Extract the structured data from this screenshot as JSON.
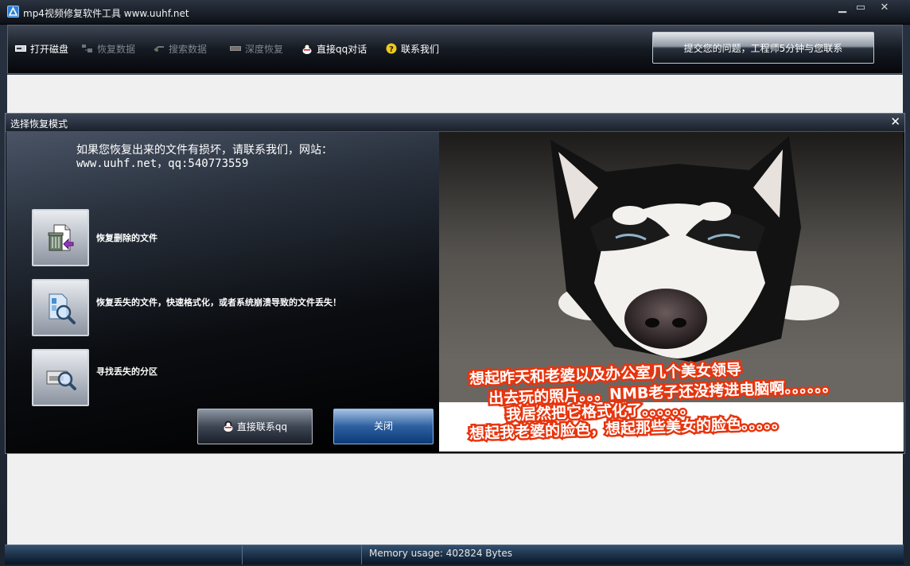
{
  "window": {
    "title": "mp4视频修复软件工具 www.uuhf.net",
    "controls": {
      "minimize": "▁",
      "maximize": "▭",
      "close": "✕"
    }
  },
  "toolbar": {
    "items": [
      {
        "label": "打开磁盘",
        "icon": "drive-icon",
        "enabled": true
      },
      {
        "label": "恢复数据",
        "icon": "recover-icon",
        "enabled": false
      },
      {
        "label": "搜索数据",
        "icon": "search-data-icon",
        "enabled": false
      },
      {
        "label": "深度恢复",
        "icon": "deep-recover-icon",
        "enabled": false
      },
      {
        "label": "直接qq对话",
        "icon": "qq-icon",
        "enabled": true
      },
      {
        "label": "联系我们",
        "icon": "help-icon",
        "enabled": true
      }
    ],
    "submit_label": "提交您的问题，工程师5分钟与您联系"
  },
  "dialog": {
    "title": "选择恢复模式",
    "close_label": "✕",
    "notice": "如果您恢复出来的文件有损坏，请联系我们，网站：www.uuhf.net，qq:540773559",
    "options": [
      {
        "label": "恢复删除的文件",
        "icon": "recycle-bin-icon"
      },
      {
        "label": "恢复丢失的文件，快速格式化，或者系统崩溃导致的文件丢失！",
        "icon": "magnify-document-icon"
      },
      {
        "label": "寻找丢失的分区",
        "icon": "partition-search-icon"
      }
    ],
    "direct_qq_label": "直接联系qq",
    "close_button_label": "关闭",
    "photo_caption": [
      "想起昨天和老婆以及办公室几个美女领导",
      "出去玩的照片。。。NMB老子还没拷进电脑啊。。。。。。",
      "我居然把它格式化了。。。。。。",
      "想起我老婆的脸色，想起那些美女的脸色。。。。。"
    ]
  },
  "statusbar": {
    "memory_text": "Memory usage: 402824 Bytes"
  },
  "colors": {
    "caption_stroke": "#e8340d",
    "disabled_text": "#7e8590",
    "close_button_accent": "#2d5f9e"
  }
}
